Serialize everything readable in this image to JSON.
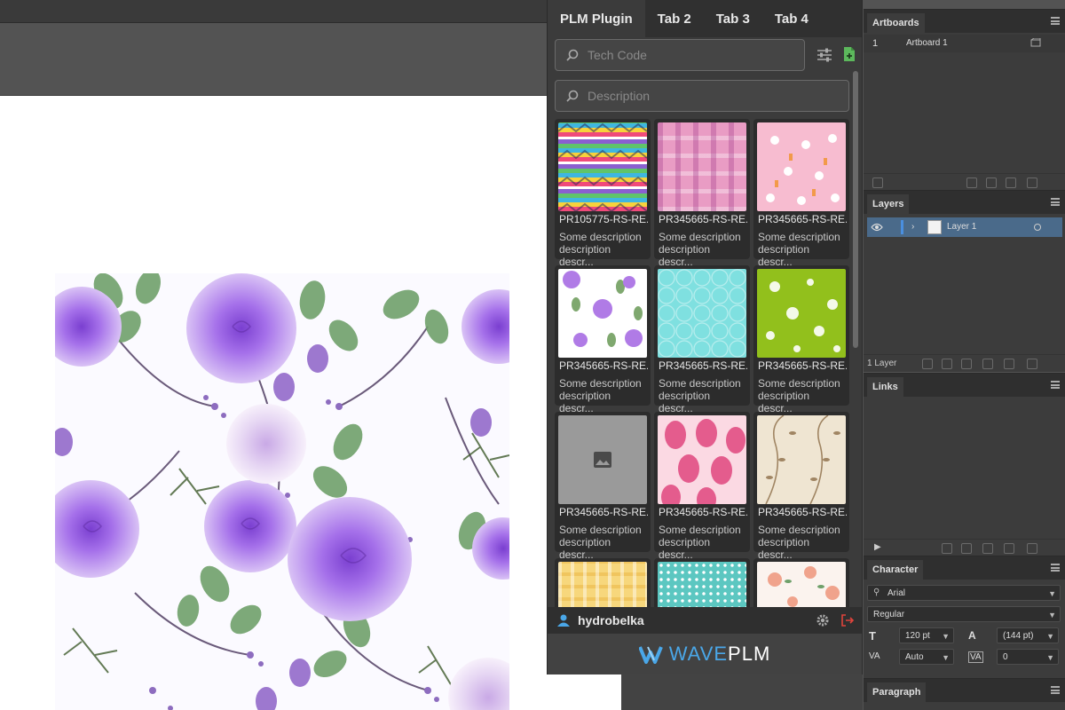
{
  "plugin": {
    "tabs": [
      {
        "label": "PLM Plugin",
        "active": true
      },
      {
        "label": "Tab 2",
        "active": false
      },
      {
        "label": "Tab 3",
        "active": false
      },
      {
        "label": "Tab 4",
        "active": false
      }
    ],
    "tech_code_placeholder": "Tech Code",
    "description_placeholder": "Description",
    "items": [
      {
        "code": "PR105775-RS-RE...",
        "desc": "Some description description descr...",
        "pattern": "zigzag"
      },
      {
        "code": "PR345665-RS-RE...",
        "desc": "Some description description descr...",
        "pattern": "plaid-pink"
      },
      {
        "code": "PR345665-RS-RE...",
        "desc": "Some description description descr...",
        "pattern": "bunnies"
      },
      {
        "code": "PR345665-RS-RE...",
        "desc": "Some description description descr...",
        "pattern": "roses"
      },
      {
        "code": "PR345665-RS-RE...",
        "desc": "Some description description descr...",
        "pattern": "trellis-aqua"
      },
      {
        "code": "PR345665-RS-RE...",
        "desc": "Some description description descr...",
        "pattern": "flowers-lime"
      },
      {
        "code": "PR345665-RS-RE...",
        "desc": "Some description description descr...",
        "pattern": "placeholder"
      },
      {
        "code": "PR345665-RS-RE...",
        "desc": "Some description description descr...",
        "pattern": "eggs"
      },
      {
        "code": "PR345665-RS-RE...",
        "desc": "Some description description descr...",
        "pattern": "vines"
      },
      {
        "code": "",
        "desc": "",
        "pattern": "plaid-yellow"
      },
      {
        "code": "",
        "desc": "",
        "pattern": "dots-teal"
      },
      {
        "code": "",
        "desc": "",
        "pattern": "floral-peach"
      }
    ],
    "username": "hydrobelka",
    "brand_wave": "WAVE",
    "brand_plm": "PLM",
    "colors": {
      "accent_blue": "#4aa7e8",
      "logout_red": "#e0443c",
      "green_doc": "#5cb85c"
    }
  },
  "artboards": {
    "title": "Artboards",
    "rows": [
      {
        "num": "1",
        "name": "Artboard 1"
      }
    ]
  },
  "layers": {
    "title": "Layers",
    "rows": [
      {
        "name": "Layer 1"
      }
    ],
    "count": "1 Layer"
  },
  "links": {
    "title": "Links"
  },
  "character": {
    "title": "Character",
    "font": "Arial",
    "style": "Regular",
    "size": "120 pt",
    "leading": "(144 pt)",
    "kerning": "Auto",
    "tracking": "0"
  },
  "paragraph": {
    "title": "Paragraph"
  }
}
